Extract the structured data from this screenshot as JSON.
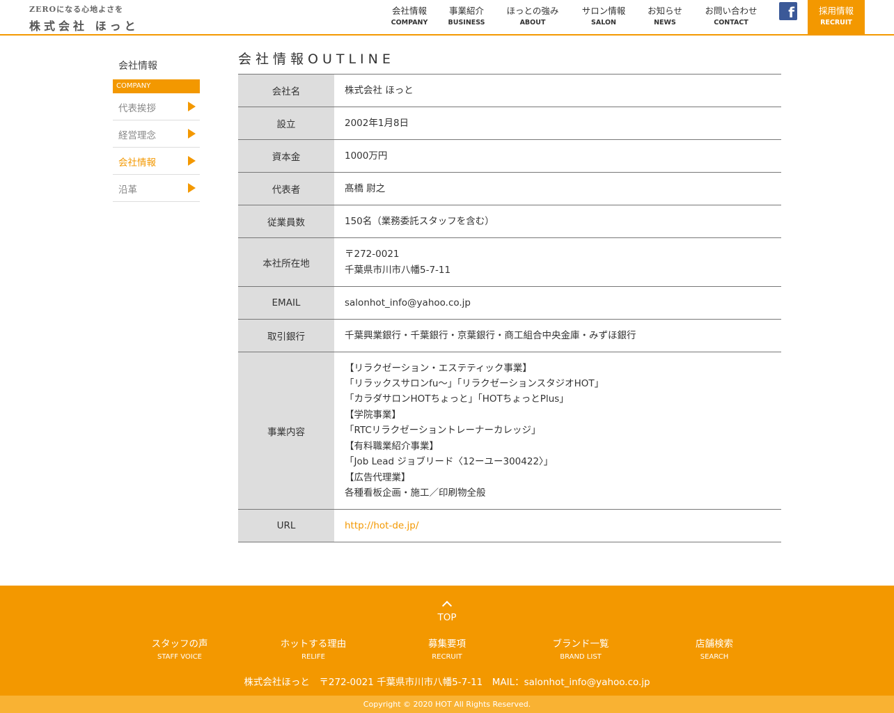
{
  "header": {
    "logo_tagline": "ZEROになる心地よさを",
    "logo_name": "株式会社 ほっと",
    "nav": [
      {
        "jp": "会社情報",
        "en": "COMPANY"
      },
      {
        "jp": "事業紹介",
        "en": "BUSINESS"
      },
      {
        "jp": "ほっとの強み",
        "en": "ABOUT"
      },
      {
        "jp": "サロン情報",
        "en": "SALON"
      },
      {
        "jp": "お知らせ",
        "en": "NEWS"
      },
      {
        "jp": "お問い合わせ",
        "en": "CONTACT"
      }
    ],
    "facebook_glyph": "f",
    "recruit": {
      "jp": "採用情報",
      "en": "RECRUIT"
    }
  },
  "sidebar": {
    "title": "会社情報",
    "subtitle": "COMPANY",
    "items": [
      {
        "label": "代表挨拶",
        "active": false
      },
      {
        "label": "経営理念",
        "active": false
      },
      {
        "label": "会社情報",
        "active": true
      },
      {
        "label": "沿革",
        "active": false
      }
    ]
  },
  "main": {
    "title": "会社情報OUTLINE",
    "rows": [
      {
        "label": "会社名",
        "lines": [
          "株式会社 ほっと"
        ]
      },
      {
        "label": "設立",
        "lines": [
          "2002年1月8日"
        ]
      },
      {
        "label": "資本金",
        "lines": [
          "1000万円"
        ]
      },
      {
        "label": "代表者",
        "lines": [
          "髙橋 尉之"
        ]
      },
      {
        "label": "従業員数",
        "lines": [
          "150名（業務委託スタッフを含む）"
        ]
      },
      {
        "label": "本社所在地",
        "lines": [
          "〒272-0021",
          "千葉県市川市八幡5-7-11"
        ]
      },
      {
        "label": "EMAIL",
        "lines": [
          "salonhot_info@yahoo.co.jp"
        ]
      },
      {
        "label": "取引銀行",
        "lines": [
          "千葉興業銀行・千葉銀行・京葉銀行・商工組合中央金庫・みずほ銀行"
        ]
      },
      {
        "label": "事業内容",
        "lines": [
          "【リラクゼーション・エステティック事業】",
          "「リラックスサロンfu～」「リラクゼーションスタジオHOT」",
          "「カラダサロンHOTちょっと」「HOTちょっとPlus」",
          "【学院事業】",
          "「RTCリラクゼーショントレーナーカレッジ」",
          "【有料職業紹介事業】",
          "「Job Lead ジョブリード〈12ーユー300422〉」",
          "【広告代理業】",
          "各種看板企画・施工／印刷物全般"
        ]
      },
      {
        "label": "URL",
        "lines": [
          "http://hot-de.jp/"
        ],
        "link": true
      }
    ]
  },
  "footer": {
    "to_top": "TOP",
    "nav": [
      {
        "jp": "スタッフの声",
        "en": "STAFF VOICE"
      },
      {
        "jp": "ホットする理由",
        "en": "RELIFE"
      },
      {
        "jp": "募集要項",
        "en": "RECRUIT"
      },
      {
        "jp": "ブランド一覧",
        "en": "BRAND LIST"
      },
      {
        "jp": "店舗検索",
        "en": "SEARCH"
      }
    ],
    "address": "株式会社ほっと　〒272-0021 千葉県市川市八幡5-7-11　MAIL：salonhot_info@yahoo.co.jp",
    "copyright": "Copyright © 2020 HOT All Rights Reserved."
  },
  "colors": {
    "accent": "#f39800",
    "accent_light": "#f9b233",
    "th_bg": "#dddddd",
    "facebook": "#3b5998"
  }
}
